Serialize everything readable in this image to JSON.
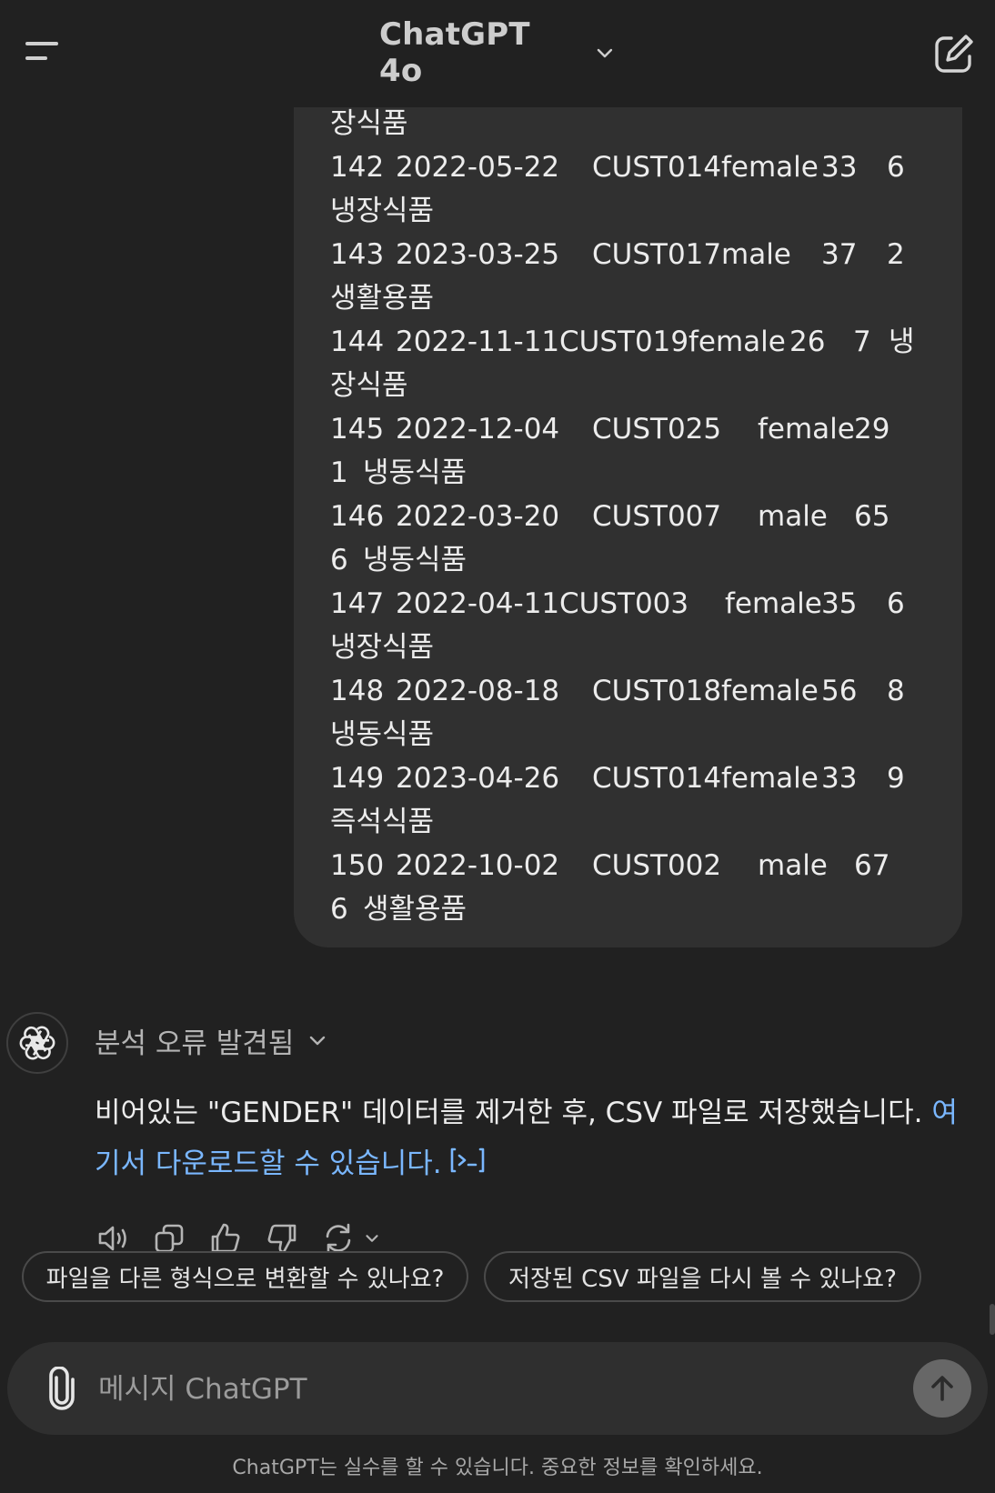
{
  "header": {
    "model_name": "ChatGPT 4o",
    "menu_icon": "hamburger-menu-icon",
    "chevron_icon": "chevron-down-icon",
    "new_chat_icon": "new-chat-edit-icon"
  },
  "user_message": {
    "leading_fragment": "장식품",
    "rows": [
      {
        "id": "142",
        "date": "2022-05-22",
        "customer": "CUST014",
        "gender": "female",
        "age": "33",
        "qty": "6",
        "category": "냉장식품"
      },
      {
        "id": "143",
        "date": "2023-03-25",
        "customer": "CUST017",
        "gender": "male",
        "age": "37",
        "qty": "2",
        "category": "생활용품"
      },
      {
        "id": "144",
        "date": "2022-11-11",
        "customer": "CUST019",
        "gender": "female",
        "age": "26",
        "qty": "7",
        "category_a": "냉",
        "category_b": "장식품"
      },
      {
        "id": "145",
        "date": "2022-12-04",
        "customer": "CUST025",
        "gender": "female",
        "age": "29",
        "qty": "1",
        "category": "냉동식품"
      },
      {
        "id": "146",
        "date": "2022-03-20",
        "customer": "CUST007",
        "gender": "male",
        "age": "65",
        "qty": "6",
        "category": "냉동식품"
      },
      {
        "id": "147",
        "date": "2022-04-11",
        "customer": "CUST003",
        "gender": "female",
        "age": "35",
        "qty": "6",
        "category": "냉장식품"
      },
      {
        "id": "148",
        "date": "2022-08-18",
        "customer": "CUST018",
        "gender": "female",
        "age": "56",
        "qty": "8",
        "category": "냉동식품"
      },
      {
        "id": "149",
        "date": "2023-04-26",
        "customer": "CUST014",
        "gender": "female",
        "age": "33",
        "qty": "9",
        "category": "즉석식품"
      },
      {
        "id": "150",
        "date": "2022-10-02",
        "customer": "CUST002",
        "gender": "male",
        "age": "67",
        "qty": "6",
        "category": "생활용품"
      }
    ]
  },
  "assistant": {
    "avatar_icon": "openai-logo-icon",
    "analysis_label": "분석 오류 발견됨",
    "message_text": "비어있는 \"GENDER\" 데이터를 제거한 후, CSV 파일로 저장했습니다. ",
    "download_link_text": "여기서 다운로드할 수 있습니다.",
    "code_badge_icon": "code-terminal-icon",
    "actions": [
      {
        "icon": "read-aloud-icon"
      },
      {
        "icon": "copy-icon"
      },
      {
        "icon": "thumbs-up-icon"
      },
      {
        "icon": "thumbs-down-icon"
      },
      {
        "icon": "regenerate-icon"
      }
    ]
  },
  "suggestions": [
    "파일을 다른 형식으로 변환할 수 있나요?",
    "저장된 CSV 파일을 다시 볼 수 있나요?"
  ],
  "composer": {
    "placeholder": "메시지 ChatGPT",
    "attach_icon": "paperclip-icon",
    "send_icon": "arrow-up-icon"
  },
  "footer": {
    "disclaimer": "ChatGPT는 실수를 할 수 있습니다. 중요한 정보를 확인하세요."
  },
  "colors": {
    "background": "#212121",
    "bubble": "#303030",
    "link": "#7ab7ff",
    "composer": "#2f2f2f"
  }
}
